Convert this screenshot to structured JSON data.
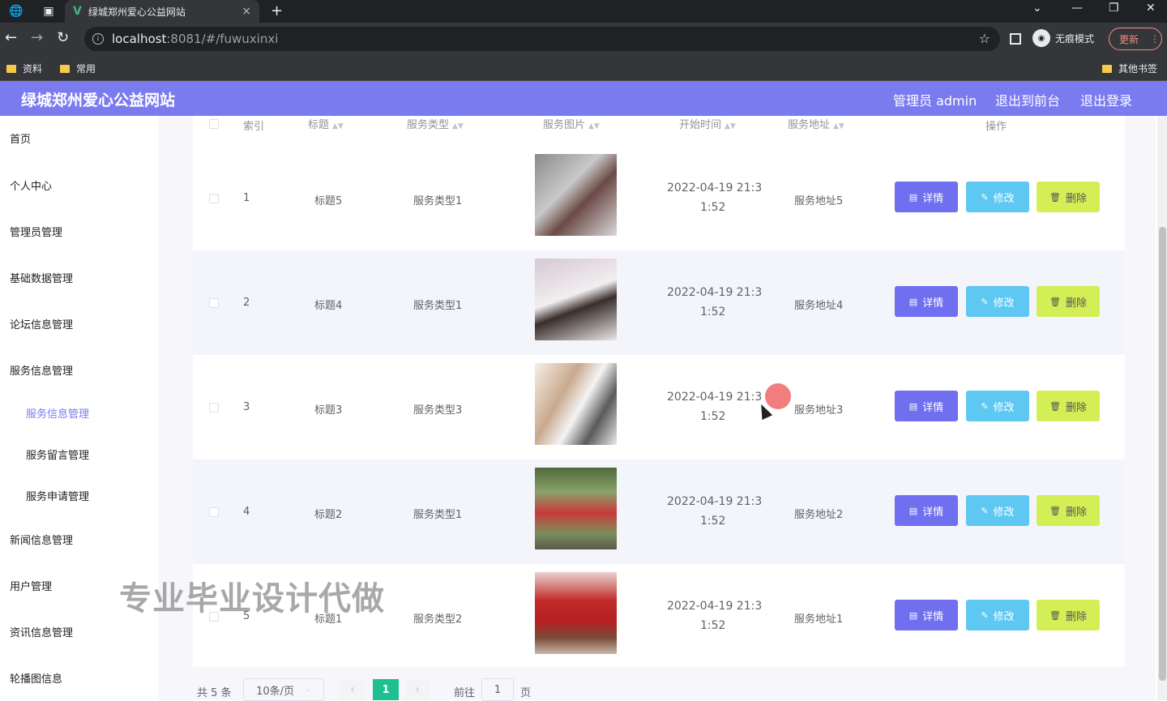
{
  "browser": {
    "tab_title": "绿城郑州爱心公益网站",
    "tab_close": "×",
    "new_tab": "+",
    "url_host": "localhost",
    "url_path": ":8081/#/fuwuxinxi",
    "incognito_label": "无痕模式",
    "update_label": "更新",
    "bookmarks": [
      "资料",
      "常用"
    ],
    "other_bookmarks": "其他书签"
  },
  "header": {
    "title": "绿城郑州爱心公益网站",
    "admin_label": "管理员 admin",
    "front_label": "退出到前台",
    "logout_label": "退出登录"
  },
  "sidebar": {
    "items": [
      {
        "label": "首页"
      },
      {
        "label": "个人中心"
      },
      {
        "label": "管理员管理"
      },
      {
        "label": "基础数据管理"
      },
      {
        "label": "论坛信息管理"
      },
      {
        "label": "服务信息管理"
      },
      {
        "label": "新闻信息管理"
      },
      {
        "label": "用户管理"
      },
      {
        "label": "资讯信息管理"
      },
      {
        "label": "轮播图信息"
      }
    ],
    "sub_items": [
      {
        "label": "服务信息管理",
        "active": true
      },
      {
        "label": "服务留言管理"
      },
      {
        "label": "服务申请管理"
      }
    ]
  },
  "watermark": "专业毕业设计代做",
  "table": {
    "columns": [
      "索引",
      "标题",
      "服务类型",
      "服务图片",
      "开始时间",
      "服务地址",
      "操作"
    ],
    "rows": [
      {
        "index": "1",
        "title": "标题5",
        "type": "服务类型1",
        "time1": "2022-04-19 21:3",
        "time2": "1:52",
        "address": "服务地址5"
      },
      {
        "index": "2",
        "title": "标题4",
        "type": "服务类型1",
        "time1": "2022-04-19 21:3",
        "time2": "1:52",
        "address": "服务地址4"
      },
      {
        "index": "3",
        "title": "标题3",
        "type": "服务类型3",
        "time1": "2022-04-19 21:3",
        "time2": "1:52",
        "address": "服务地址3"
      },
      {
        "index": "4",
        "title": "标题2",
        "type": "服务类型1",
        "time1": "2022-04-19 21:3",
        "time2": "1:52",
        "address": "服务地址2"
      },
      {
        "index": "5",
        "title": "标题1",
        "type": "服务类型2",
        "time1": "2022-04-19 21:3",
        "time2": "1:52",
        "address": "服务地址1"
      }
    ],
    "actions": {
      "detail": "详情",
      "edit": "修改",
      "delete": "删除"
    }
  },
  "pagination": {
    "total": "共 5 条",
    "page_size": "10条/页",
    "current": "1",
    "goto_label": "前往",
    "goto_value": "1",
    "page_suffix": "页"
  },
  "colors": {
    "header": "#7b7bf0",
    "detail": "#6f6ff0",
    "edit": "#5ec8f2",
    "delete": "#d4ee56",
    "page_active": "#1dc08e"
  }
}
